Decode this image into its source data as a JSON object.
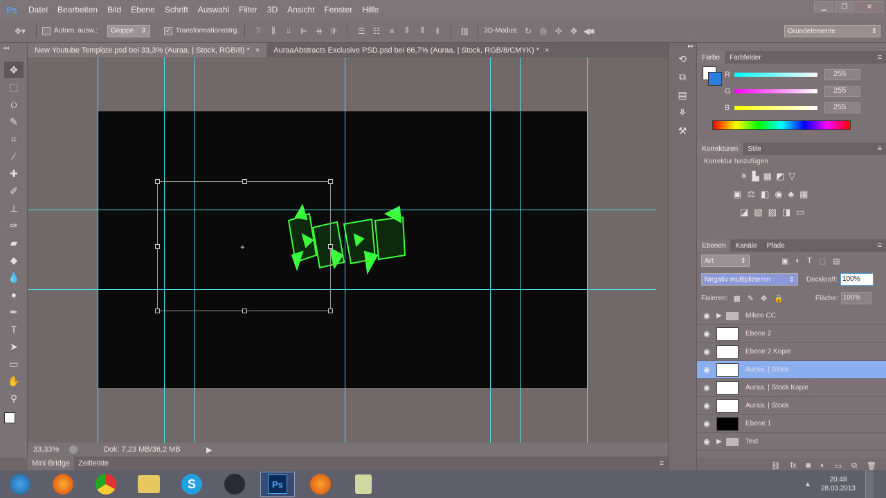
{
  "menubar": {
    "logo": "Ps",
    "items": [
      "Datei",
      "Bearbeiten",
      "Bild",
      "Ebene",
      "Schrift",
      "Auswahl",
      "Filter",
      "3D",
      "Ansicht",
      "Fenster",
      "Hilfe"
    ]
  },
  "options": {
    "auto_select": "Autom. ausw.:",
    "group_select": "Gruppe",
    "transform": "Transformationsstrg.",
    "mode_3d": "3D-Modus:",
    "workspace": "Grundelemente"
  },
  "tabs": [
    {
      "label": "New Youtube Template.psd bei 33,3% (Auraa. | Stock, RGB/8) *",
      "close": "×"
    },
    {
      "label": "AuraaAbstracts Exclusive PSD.psd bei 66,7% (Auraa. | Stock, RGB/8/CMYK) *",
      "close": "×"
    }
  ],
  "status": {
    "zoom": "33,33%",
    "doc": "Dok: 7,23 MB/36,2 MB"
  },
  "mini": {
    "bridge": "Mini Bridge",
    "timeline": "Zeitleiste"
  },
  "color_panel": {
    "tabs": [
      "Farbe",
      "Farbfelder"
    ],
    "channels": [
      {
        "name": "R",
        "value": "255"
      },
      {
        "name": "G",
        "value": "255"
      },
      {
        "name": "B",
        "value": "255"
      }
    ]
  },
  "adjust_panel": {
    "tabs": [
      "Korrekturen",
      "Stile"
    ],
    "heading": "Korrektur hinzufügen"
  },
  "layers_panel": {
    "tabs": [
      "Ebenen",
      "Kanäle",
      "Pfade"
    ],
    "kind": "Art",
    "blend_mode": "Negativ multiplizieren",
    "opacity_label": "Deckkraft:",
    "opacity_value": "100%",
    "lock_label": "Fixieren:",
    "fill_label": "Fläche:",
    "fill_value": "100%",
    "layers": [
      {
        "name": "Mikee CC",
        "folder": true
      },
      {
        "name": "Ebene 2",
        "folder": false
      },
      {
        "name": "Ebene 2 Kopie",
        "folder": false
      },
      {
        "name": "Auraa. | Stock",
        "folder": false,
        "selected": true
      },
      {
        "name": "Auraa. | Stock Kopie",
        "folder": false
      },
      {
        "name": "Auraa. | Stock",
        "folder": false
      },
      {
        "name": "Ebene 1",
        "folder": false,
        "black": true
      },
      {
        "name": "Text",
        "folder": true
      }
    ]
  },
  "taskbar": {
    "time": "20:48",
    "date": "28.03.2013"
  },
  "colors": {
    "guide": "#4fe0e8",
    "accent_green": "#3cff3c",
    "selection": "#8aaef0"
  }
}
